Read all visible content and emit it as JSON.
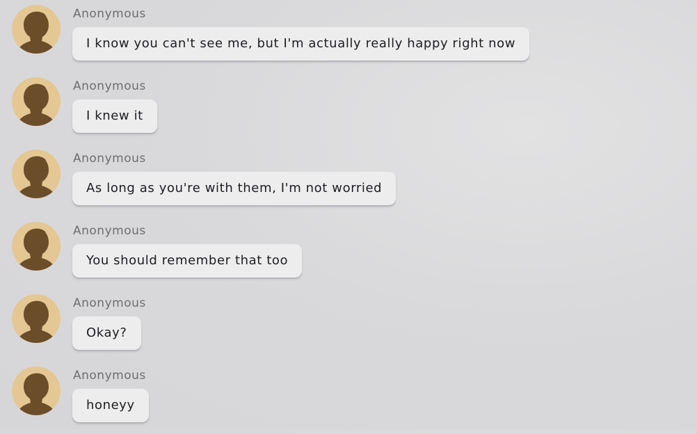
{
  "colors": {
    "avatar_bg": "#e4c793",
    "avatar_silhouette": "#6b4d2a",
    "bubble_bg": "#ededee",
    "sender_text": "#6e6e72",
    "message_text": "#1d1d20"
  },
  "messages": [
    {
      "sender": "Anonymous",
      "avatar_icon": "user-silhouette-icon",
      "text": "I know you can't see me, but I'm actually really happy right now"
    },
    {
      "sender": "Anonymous",
      "avatar_icon": "user-silhouette-icon",
      "text": "I knew it"
    },
    {
      "sender": "Anonymous",
      "avatar_icon": "user-silhouette-icon",
      "text": "As long as you're with them, I'm not worried"
    },
    {
      "sender": "Anonymous",
      "avatar_icon": "user-silhouette-icon",
      "text": "You should remember that too"
    },
    {
      "sender": "Anonymous",
      "avatar_icon": "user-silhouette-icon",
      "text": "Okay?"
    },
    {
      "sender": "Anonymous",
      "avatar_icon": "user-silhouette-icon",
      "text": "honeyy"
    }
  ]
}
